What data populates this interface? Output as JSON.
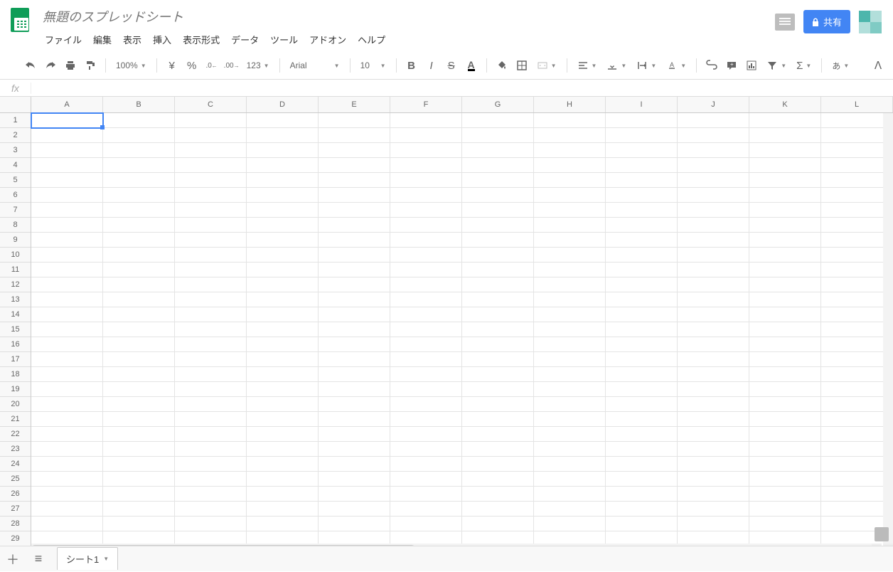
{
  "doc": {
    "title": "無題のスプレッドシート"
  },
  "menu": [
    "ファイル",
    "編集",
    "表示",
    "挿入",
    "表示形式",
    "データ",
    "ツール",
    "アドオン",
    "ヘルプ"
  ],
  "share": {
    "label": "共有"
  },
  "toolbar": {
    "zoom": "100%",
    "currency": "¥",
    "percent": "%",
    "dec_dec": ".0",
    "inc_dec": ".00",
    "more_formats": "123",
    "font": "Arial",
    "font_size": "10",
    "bold": "B",
    "italic": "I",
    "strike": "S",
    "textcolor": "A",
    "ime": "あ"
  },
  "fx": {
    "label": "fx",
    "value": ""
  },
  "columns": [
    "A",
    "B",
    "C",
    "D",
    "E",
    "F",
    "G",
    "H",
    "I",
    "J",
    "K",
    "L"
  ],
  "rows": [
    1,
    2,
    3,
    4,
    5,
    6,
    7,
    8,
    9,
    10,
    11,
    12,
    13,
    14,
    15,
    16,
    17,
    18,
    19,
    20,
    21,
    22,
    23,
    24,
    25,
    26,
    27,
    28,
    29
  ],
  "selected_cell": "A1",
  "sheet": {
    "name": "シート1"
  }
}
